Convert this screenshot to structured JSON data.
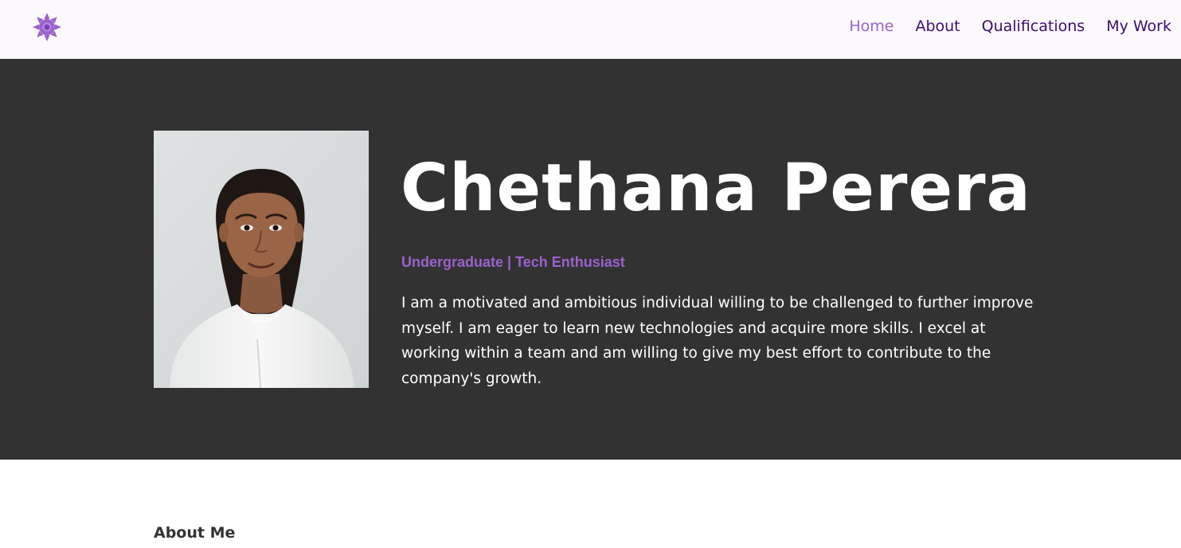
{
  "nav": {
    "logo_icon": "sun-icon",
    "accent_color": "#9b62cc",
    "items": [
      {
        "label": "Home",
        "active": true
      },
      {
        "label": "About",
        "active": false
      },
      {
        "label": "Qualifications",
        "active": false
      },
      {
        "label": "My Work",
        "active": false
      }
    ]
  },
  "hero": {
    "name": "Chethana Perera",
    "subtitle": "Undergraduate | Tech Enthusiast",
    "bio": "I am a motivated and ambitious individual willing to be challenged to further improve myself. I am eager to learn new technologies and acquire more skills. I excel at working within a team and am willing to give my best effort to contribute to the company's growth.",
    "background_color": "#323232"
  },
  "about": {
    "heading": "About Me"
  }
}
